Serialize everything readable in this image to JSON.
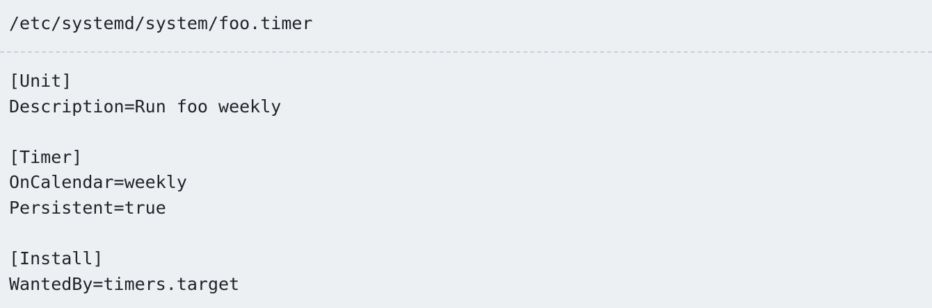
{
  "file": {
    "path": "/etc/systemd/system/foo.timer"
  },
  "code": {
    "lines": [
      "[Unit]",
      "Description=Run foo weekly",
      "",
      "[Timer]",
      "OnCalendar=weekly",
      "Persistent=true",
      "",
      "[Install]",
      "WantedBy=timers.target"
    ]
  }
}
